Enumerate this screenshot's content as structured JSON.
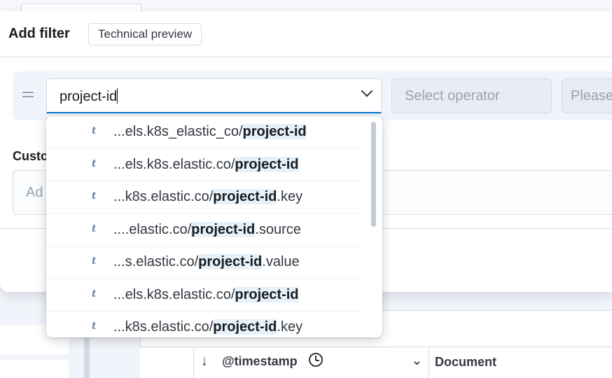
{
  "popover": {
    "title": "Add filter",
    "badge": "Technical preview"
  },
  "filter": {
    "field_value": "project-id",
    "operator_placeholder": "Select operator",
    "value_placeholder": "Please"
  },
  "custom": {
    "label_partial": "Custo",
    "input_partial": "Ad"
  },
  "dropdown": {
    "type_icon": "t",
    "items": [
      {
        "prefix": "...els.k8s_elastic_co/",
        "match": "project-id",
        "suffix": ""
      },
      {
        "prefix": "...els.k8s.elastic.co/",
        "match": "project-id",
        "suffix": ""
      },
      {
        "prefix": "...k8s.elastic.co/",
        "match": "project-id",
        "suffix": ".key"
      },
      {
        "prefix": "....elastic.co/",
        "match": "project-id",
        "suffix": ".source"
      },
      {
        "prefix": "...s.elastic.co/",
        "match": "project-id",
        "suffix": ".value"
      },
      {
        "prefix": "...els.k8s.elastic.co/",
        "match": "project-id",
        "suffix": ""
      },
      {
        "prefix": "...k8s.elastic.co/",
        "match": "project-id",
        "suffix": ".key"
      }
    ]
  },
  "table": {
    "timestamp_header": "@timestamp",
    "document_header": "Document",
    "sort_icon": "arrow-down-icon"
  },
  "colors": {
    "accent": "#0077cc",
    "highlight": "#e6f1fa"
  }
}
